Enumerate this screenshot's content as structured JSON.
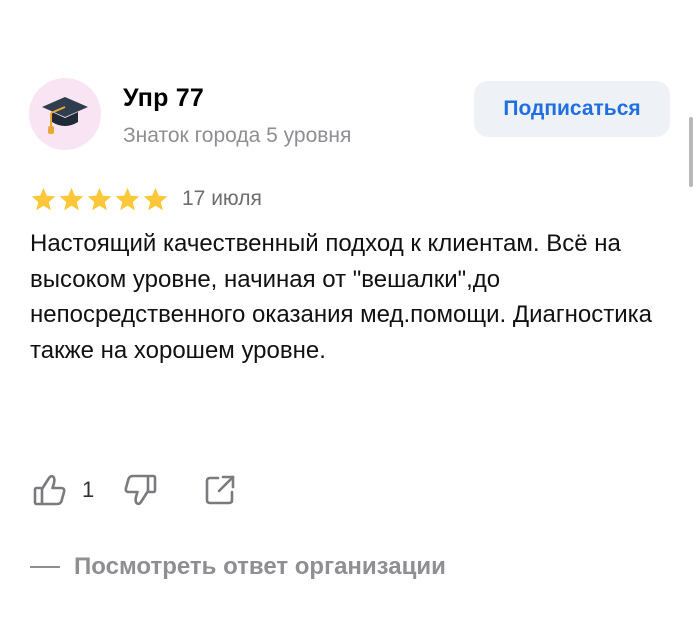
{
  "header": {
    "user_name": "Упр 77",
    "user_status": "Знаток города 5 уровня",
    "subscribe_label": "Подписаться",
    "avatar_icon": "graduation-cap-icon"
  },
  "review": {
    "rating": 5,
    "rating_max": 5,
    "date": "17 июля",
    "text": "Настоящий качественный подход к клиентам. Всё на высоком уровне, начиная от \"вешалки\",до непосредственного оказания мед.помощи. Диагностика также на хорошем уровне."
  },
  "actions": {
    "like_icon": "thumbs-up-icon",
    "like_count": "1",
    "dislike_icon": "thumbs-down-icon",
    "share_icon": "share-icon"
  },
  "org_reply": {
    "label": "Посмотреть ответ организации"
  },
  "colors": {
    "accent": "#1f6fe0",
    "star": "#fcc83a",
    "muted": "#8e8e93",
    "avatar_bg": "#f8e4f2",
    "button_bg": "#eef1f5"
  }
}
